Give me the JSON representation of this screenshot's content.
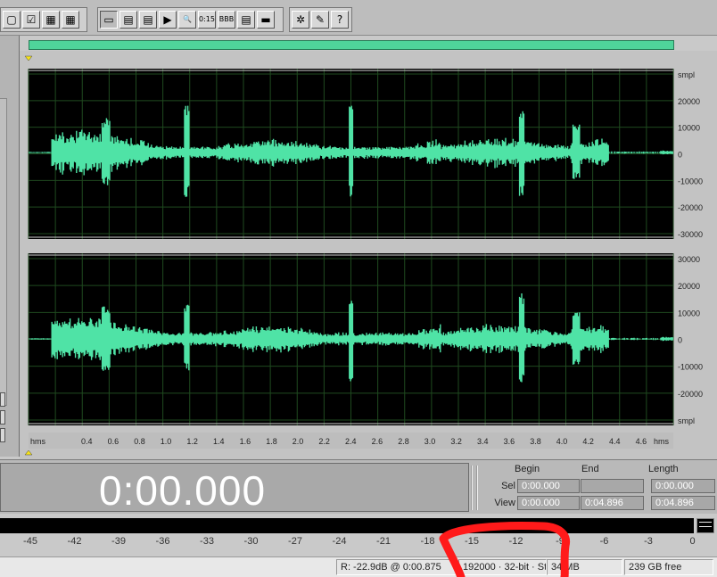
{
  "toolbar": {
    "groups": [
      {
        "buttons": [
          {
            "icon": "wave-view-icon",
            "glyph": "▢"
          },
          {
            "icon": "checkbox-icon",
            "glyph": "☑"
          },
          {
            "icon": "multitrack-icon",
            "glyph": "▦"
          },
          {
            "icon": "grid-icon",
            "glyph": "▦"
          }
        ]
      },
      {
        "buttons": [
          {
            "icon": "window-icon",
            "glyph": "▭"
          },
          {
            "icon": "file-icon",
            "glyph": "▤"
          },
          {
            "icon": "list-icon",
            "glyph": "▤"
          },
          {
            "icon": "play-icon",
            "glyph": "▶"
          },
          {
            "icon": "zoom-icon",
            "glyph": "🔍"
          },
          {
            "icon": "time-format-icon",
            "glyph": "0:15"
          },
          {
            "icon": "bbb-icon",
            "glyph": "BBB"
          },
          {
            "icon": "color-bars-icon",
            "glyph": "▤"
          },
          {
            "icon": "panel-icon",
            "glyph": "▬"
          }
        ]
      },
      {
        "buttons": [
          {
            "icon": "effects-icon",
            "glyph": "✲"
          },
          {
            "icon": "edit-icon",
            "glyph": "✎"
          },
          {
            "icon": "help-icon",
            "glyph": "?"
          }
        ]
      }
    ]
  },
  "waveform": {
    "color": "#4fe3a6",
    "background": "#000000",
    "grid_color": "#1f4a1f",
    "channels": [
      {
        "name": "L",
        "ticks": [
          "smpl",
          "20000",
          "10000",
          "0",
          "-10000",
          "-20000",
          "-30000"
        ]
      },
      {
        "name": "R",
        "ticks": [
          "30000",
          "20000",
          "10000",
          "0",
          "-10000",
          "-20000",
          "smpl"
        ]
      }
    ],
    "timeline_labels": [
      "hms",
      "0.4",
      "0.6",
      "0.8",
      "1.0",
      "1.2",
      "1.4",
      "1.6",
      "1.8",
      "2.0",
      "2.2",
      "2.4",
      "2.6",
      "2.8",
      "3.0",
      "3.2",
      "3.4",
      "3.6",
      "3.8",
      "4.0",
      "4.2",
      "4.4",
      "4.6",
      "hms"
    ]
  },
  "transport": {
    "time": "0:00.000"
  },
  "selection": {
    "headers": {
      "begin": "Begin",
      "end": "End",
      "length": "Length"
    },
    "sel": {
      "label": "Sel",
      "begin": "0:00.000",
      "end": "",
      "length": "0:00.000"
    },
    "view": {
      "label": "View",
      "begin": "0:00.000",
      "end": "0:04.896",
      "length": "0:04.896"
    }
  },
  "level_meter": {
    "scale": [
      "-45",
      "-42",
      "-39",
      "-36",
      "-33",
      "-30",
      "-27",
      "-24",
      "-21",
      "-18",
      "-15",
      "-12",
      "-9",
      "-6",
      "-3",
      "0"
    ]
  },
  "status": {
    "level": "R: -22.9dB @  0:00.875",
    "format": "192000 · 32-bit · Stereo",
    "size": "34 MB",
    "free": "239 GB free"
  },
  "annotation_color": "#ff1a1a"
}
